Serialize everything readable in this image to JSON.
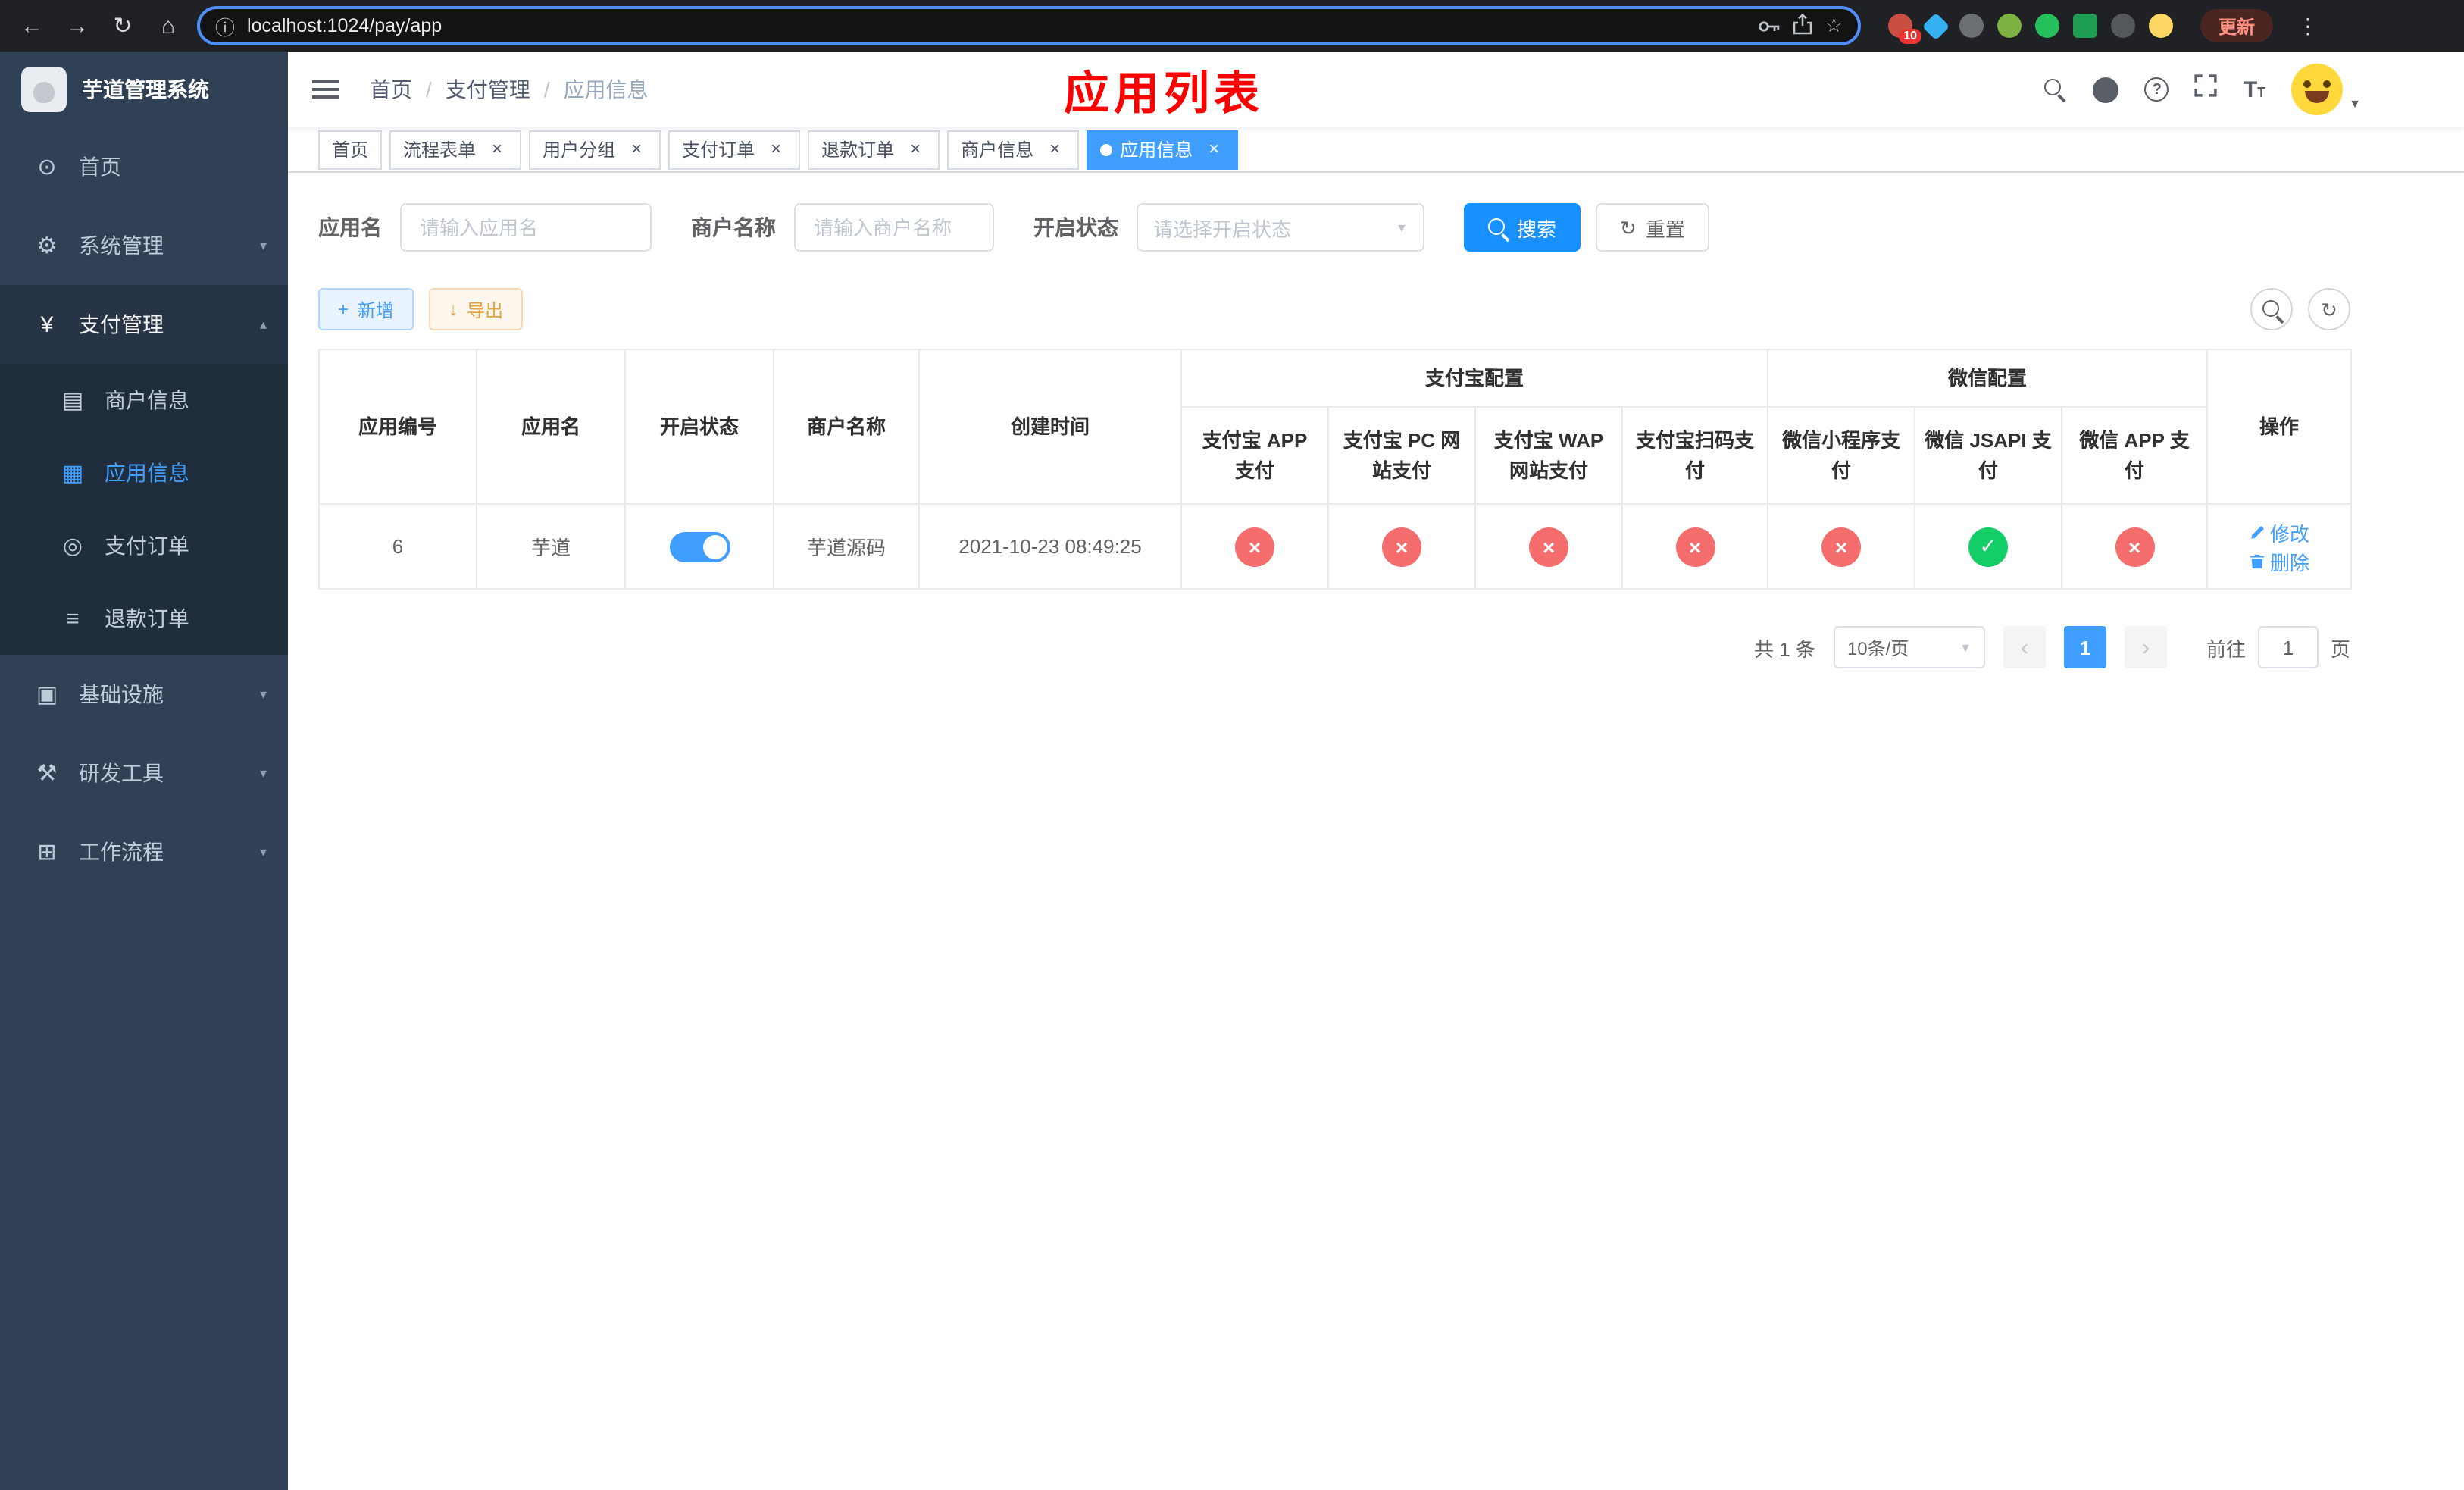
{
  "browser": {
    "url": "localhost:1024/pay/app",
    "update_label": "更新",
    "extension_badge": "10"
  },
  "sidebar": {
    "logo_title": "芋道管理系统",
    "items": {
      "home": "首页",
      "system": "系统管理",
      "pay": "支付管理",
      "merchant": "商户信息",
      "app": "应用信息",
      "order": "支付订单",
      "refund": "退款订单",
      "infra": "基础设施",
      "dev": "研发工具",
      "workflow": "工作流程"
    }
  },
  "header": {
    "breadcrumb": {
      "home": "首页",
      "section": "支付管理",
      "current": "应用信息"
    },
    "overlay_title": "应用列表"
  },
  "tabs": [
    {
      "label": "首页",
      "closable": false,
      "active": false
    },
    {
      "label": "流程表单",
      "closable": true,
      "active": false
    },
    {
      "label": "用户分组",
      "closable": true,
      "active": false
    },
    {
      "label": "支付订单",
      "closable": true,
      "active": false
    },
    {
      "label": "退款订单",
      "closable": true,
      "active": false
    },
    {
      "label": "商户信息",
      "closable": true,
      "active": false
    },
    {
      "label": "应用信息",
      "closable": true,
      "active": true
    }
  ],
  "filters": {
    "app_name_label": "应用名",
    "app_name_placeholder": "请输入应用名",
    "merchant_label": "商户名称",
    "merchant_placeholder": "请输入商户名称",
    "status_label": "开启状态",
    "status_placeholder": "请选择开启状态",
    "search_label": "搜索",
    "reset_label": "重置"
  },
  "toolbar": {
    "add_label": "新增",
    "export_label": "导出"
  },
  "table": {
    "groups": {
      "alipay": "支付宝配置",
      "wechat": "微信配置"
    },
    "columns": [
      "应用编号",
      "应用名",
      "开启状态",
      "商户名称",
      "创建时间",
      "支付宝 APP 支付",
      "支付宝 PC 网站支付",
      "支付宝 WAP 网站支付",
      "支付宝扫码支付",
      "微信小程序支付",
      "微信 JSAPI 支付",
      "微信 APP 支付",
      "操作"
    ],
    "row": {
      "id": "6",
      "name": "芋道",
      "enabled": true,
      "merchant": "芋道源码",
      "created": "2021-10-23 08:49:25",
      "channels": [
        "no",
        "no",
        "no",
        "no",
        "no",
        "yes",
        "no"
      ],
      "edit_label": "修改",
      "delete_label": "删除"
    }
  },
  "pagination": {
    "total": "共 1 条",
    "page_size": "10条/页",
    "current_page": "1",
    "goto_prefix": "前往",
    "goto_value": "1",
    "goto_suffix": "页"
  },
  "icons": {
    "back": "←",
    "forward": "→",
    "reload": "↻",
    "home": "⌂",
    "info": "ⓘ",
    "star": "☆",
    "dots": "⋮",
    "dashboard": "⊙",
    "gear": "⚙",
    "yen": "¥",
    "card": "▤",
    "grid": "▦",
    "order": "◎",
    "doc": "≡",
    "infra": "▣",
    "tools": "⚒",
    "workflow": "⊞",
    "chevron_down": "▾",
    "chevron_up": "▴",
    "caret": "▼",
    "close": "×",
    "check": "✓",
    "cross": "×",
    "plus": "+",
    "download": "↓",
    "refresh": "↻",
    "prev": "‹",
    "next": "›",
    "question": "?"
  },
  "colors": {
    "primary": "#409eff",
    "search_blue": "#1890ff",
    "danger_red": "#f56c6c",
    "success_green": "#13ce66",
    "warning_orange": "#e6a23c",
    "title_red": "#ff0000",
    "sidebar_bg": "#304156",
    "submenu_bg": "#1f2d3d"
  }
}
